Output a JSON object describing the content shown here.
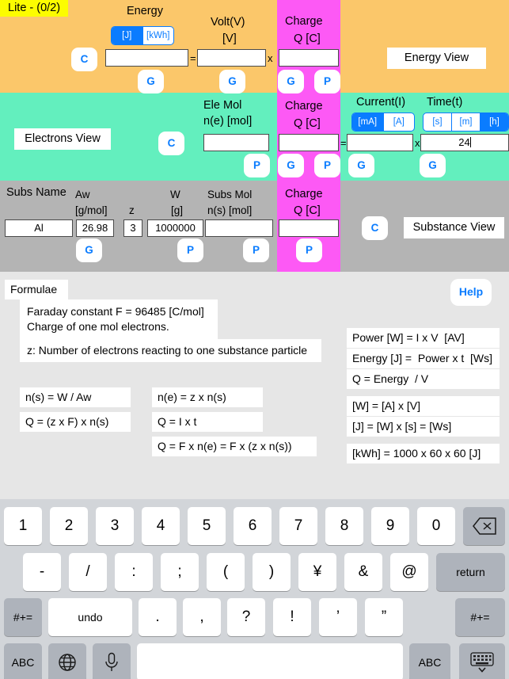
{
  "badge": {
    "text": "Lite - (0/2)"
  },
  "energy_row": {
    "energy_label": "Energy",
    "energy_units": [
      "[J]",
      "[kWh]"
    ],
    "energy_unit_selected": "[J]",
    "energy_value": "",
    "volt_label": "Volt(V)",
    "volt_unit": "[V]",
    "volt_value": "",
    "charge_label": "Charge",
    "charge_unit": "Q [C]",
    "charge_value": "",
    "equals": "=",
    "times": "x",
    "clear_label": "C",
    "get_label": "G",
    "put_label": "P",
    "view_button": "Energy View"
  },
  "electrons_row": {
    "view_button": "Electrons View",
    "clear_label": "C",
    "ele_mol_label": "Ele Mol",
    "ele_mol_unit": "n(e) [mol]",
    "ele_mol_value": "",
    "charge_label": "Charge",
    "charge_unit": "Q [C]",
    "charge_value": "",
    "current_label": "Current(I)",
    "current_units": [
      "[mA]",
      "[A]"
    ],
    "current_unit_selected": "[mA]",
    "current_value": "",
    "time_label": "Time(t)",
    "time_units": [
      "[s]",
      "[m]",
      "[h]"
    ],
    "time_unit_selected": "[h]",
    "time_value": "24",
    "equals": "=",
    "times": "x",
    "get_label": "G",
    "put_label": "P"
  },
  "substance_row": {
    "subs_name_label": "Subs Name",
    "subs_name_value": "Al",
    "aw_label": "Aw",
    "aw_unit": "[g/mol]",
    "aw_value": "26.98",
    "z_label": "z",
    "z_value": "3",
    "w_label": "W",
    "w_unit": "[g]",
    "w_value": "1000000",
    "subs_mol_label": "Subs Mol",
    "subs_mol_unit": "n(s) [mol]",
    "subs_mol_value": "",
    "charge_label": "Charge",
    "charge_unit": "Q [C]",
    "charge_value": "",
    "get_label": "G",
    "put_label": "P",
    "clear_label": "C",
    "view_button": "Substance View"
  },
  "formulae": {
    "title": "Formulae",
    "help_label": "Help",
    "faraday_note": "Faraday constant  F = 96485 [C/mol]\nCharge of one mol electrons.",
    "z_note": "z: Number of electrons reacting to one substance particle",
    "left_formulas": [
      "n(s) = W / Aw",
      "Q = (z x F) x n(s)"
    ],
    "mid_formulas": [
      "n(e) = z x n(s)",
      "Q = I x t",
      "Q = F x n(e) = F x (z x n(s))"
    ],
    "right_formulas": [
      "Power [W] = I x V  [AV]",
      "Energy [J] =  Power x t  [Ws]",
      "Q = Energy  / V",
      "[W] = [A] x [V]",
      "[J] = [W] x [s] = [Ws]",
      "[kWh] = 1000 x 60 x 60 [J]"
    ]
  },
  "keyboard": {
    "row1": [
      "1",
      "2",
      "3",
      "4",
      "5",
      "6",
      "7",
      "8",
      "9",
      "0"
    ],
    "backspace_icon": "backspace-icon",
    "row2": [
      "-",
      "/",
      ":",
      ";",
      "(",
      ")",
      "¥",
      "&",
      "@"
    ],
    "return_label": "return",
    "row3_left": "#+=",
    "undo_label": "undo",
    "row3": [
      ".",
      ",",
      "?",
      "!",
      "’",
      "”"
    ],
    "row3_right": "#+=",
    "abc_left": "ABC",
    "globe_icon": "globe-icon",
    "mic_icon": "microphone-icon",
    "space_label": "",
    "abc_right": "ABC",
    "dismiss_icon": "keyboard-dismiss-icon"
  },
  "colors": {
    "accent": "#0a7cff",
    "energy_section": "#fbc76a",
    "electrons_section": "#63efbe",
    "substance_section": "#b4b4b4",
    "charge_column": "#fd59f5",
    "badge": "#fcfc00"
  }
}
